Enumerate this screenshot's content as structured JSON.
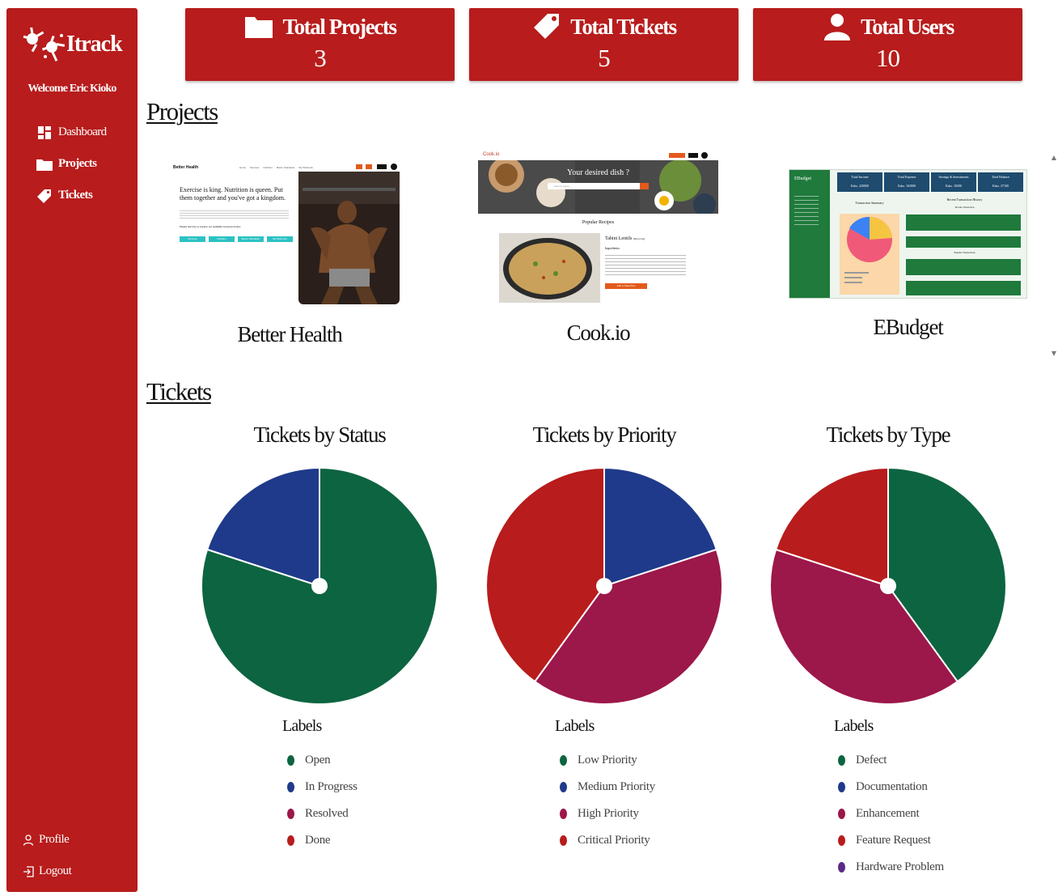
{
  "sidebar": {
    "brand": "Itrack",
    "welcome": "Welcome Eric Kioko",
    "nav": [
      {
        "label": "Dashboard",
        "icon": "dashboard-icon"
      },
      {
        "label": "Projects",
        "icon": "folder-icon"
      },
      {
        "label": "Tickets",
        "icon": "tag-icon"
      }
    ],
    "bottom": [
      {
        "label": "Profile",
        "icon": "user-icon"
      },
      {
        "label": "Logout",
        "icon": "logout-icon"
      }
    ]
  },
  "stats": [
    {
      "title": "Total Projects",
      "value": "3",
      "icon": "folder-icon"
    },
    {
      "title": "Total Tickets",
      "value": "5",
      "icon": "tag-icon"
    },
    {
      "title": "Total Users",
      "value": "10",
      "icon": "user-icon"
    }
  ],
  "projects": {
    "heading": "Projects",
    "items": [
      {
        "name": "Better Health",
        "thumb": {
          "logo": "Better Health",
          "nav": [
            "Home",
            "Services",
            "Nutrition",
            "Macro Calculator",
            "My Workouts"
          ],
          "headline": "Exercise is king. Nutrition is queen. Put them together and you've got a kingdom.",
          "cta": "Please feel free to explore our available resources below",
          "buttons": [
            "Services",
            "Nutrition",
            "Macro Calculator",
            "My Workouts"
          ]
        }
      },
      {
        "name": "Cook.io",
        "thumb": {
          "logo": "Cook.io",
          "hero": "Your desired dish ?",
          "search_placeholder": "Search recipe...",
          "section": "Popular Recipes",
          "recipe": "Tahini Lentils",
          "recipe_origin": "(Moroccan)",
          "ingredients_label": "Ingredients",
          "button": "Add to Meal Plan"
        }
      },
      {
        "name": "EBudget",
        "thumb": {
          "logo": "EBudget",
          "cards": [
            {
              "title": "Total Income",
              "value": "Kshs. 220000"
            },
            {
              "title": "Total Expense",
              "value": "Kshs. 102000"
            },
            {
              "title": "Savings & Investments",
              "value": "Kshs. 18200"
            },
            {
              "title": "Total Balance",
              "value": "Kshs. 27100"
            }
          ],
          "summary": "Transaction Summary",
          "history": "Recent Transaction History",
          "income_label": "Income Transaction",
          "expense_label": "Expense Transactions"
        }
      }
    ]
  },
  "tickets": {
    "heading": "Tickets"
  },
  "colors": {
    "brand": "#b81c1c",
    "green": "#0d6440",
    "blue": "#1f3a8a",
    "crimson": "#9c174a",
    "red": "#b81c1c",
    "purple": "#5b2a86"
  },
  "chart_data": [
    {
      "type": "pie",
      "title": "Tickets by Status",
      "legend_title": "Labels",
      "categories": [
        "Open",
        "In Progress",
        "Resolved",
        "Done"
      ],
      "values": [
        4,
        1,
        0,
        0
      ],
      "colors": [
        "#0d6440",
        "#1f3a8a",
        "#9c174a",
        "#b81c1c"
      ]
    },
    {
      "type": "pie",
      "title": "Tickets by Priority",
      "legend_title": "Labels",
      "categories": [
        "Low Priority",
        "Medium Priority",
        "High Priority",
        "Critical Priority"
      ],
      "values": [
        0,
        1,
        2,
        2
      ],
      "colors": [
        "#0d6440",
        "#1f3a8a",
        "#9c174a",
        "#b81c1c"
      ]
    },
    {
      "type": "pie",
      "title": "Tickets by Type",
      "legend_title": "Labels",
      "categories": [
        "Defect",
        "Documentation",
        "Enhancement",
        "Feature Request",
        "Hardware Problem"
      ],
      "values": [
        2,
        0,
        2,
        1,
        0
      ],
      "colors": [
        "#0d6440",
        "#1f3a8a",
        "#9c174a",
        "#b81c1c",
        "#5b2a86"
      ]
    }
  ]
}
